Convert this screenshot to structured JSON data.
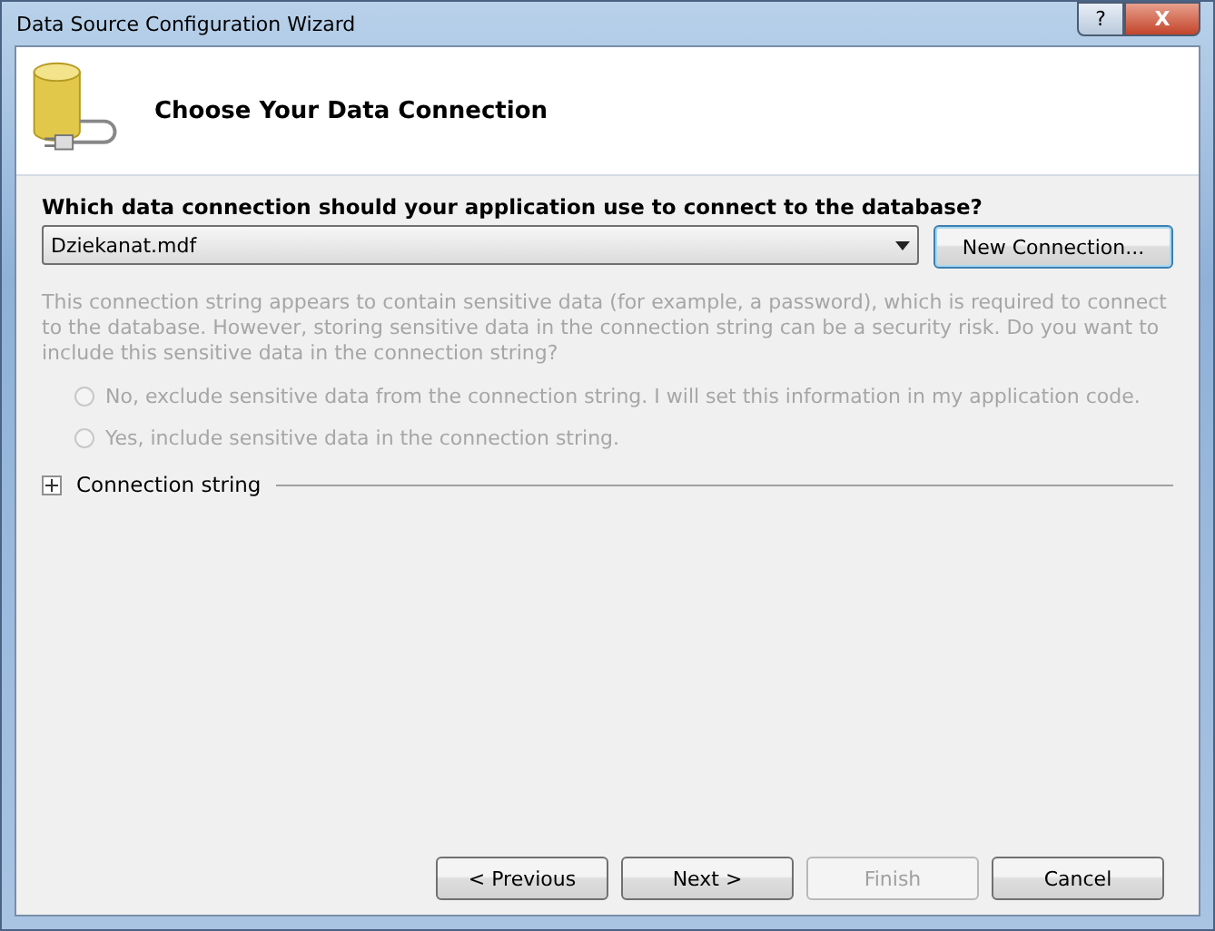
{
  "window": {
    "title": "Data Source Configuration Wizard",
    "help_button": "?",
    "close_button": "X"
  },
  "header": {
    "title": "Choose Your Data Connection"
  },
  "question": "Which data connection should your application use to connect to the database?",
  "connection_dropdown": {
    "value": "Dziekanat.mdf"
  },
  "new_connection_button": {
    "label": "New Connection...",
    "disabled": false
  },
  "sensitive_data_note": {
    "text": "This connection string appears to contain sensitive data (for example, a password), which is required to connect to the database. However, storing sensitive data in the connection string can be a security risk. Do you want to include this sensitive data in the connection string?",
    "disabled": true
  },
  "options": [
    {
      "label": "No, exclude sensitive data from the connection string. I will set this information in my application code.",
      "selected": false,
      "disabled": true
    },
    {
      "label": "Yes, include sensitive data in the connection string.",
      "selected": false,
      "disabled": true
    }
  ],
  "connection_string_section": {
    "label": "Connection string",
    "expanded": false
  },
  "buttons": [
    {
      "label": "< Previous",
      "disabled": false
    },
    {
      "label": "Next >",
      "disabled": false
    },
    {
      "label": "Finish",
      "disabled": true
    },
    {
      "label": "Cancel",
      "disabled": false
    }
  ]
}
